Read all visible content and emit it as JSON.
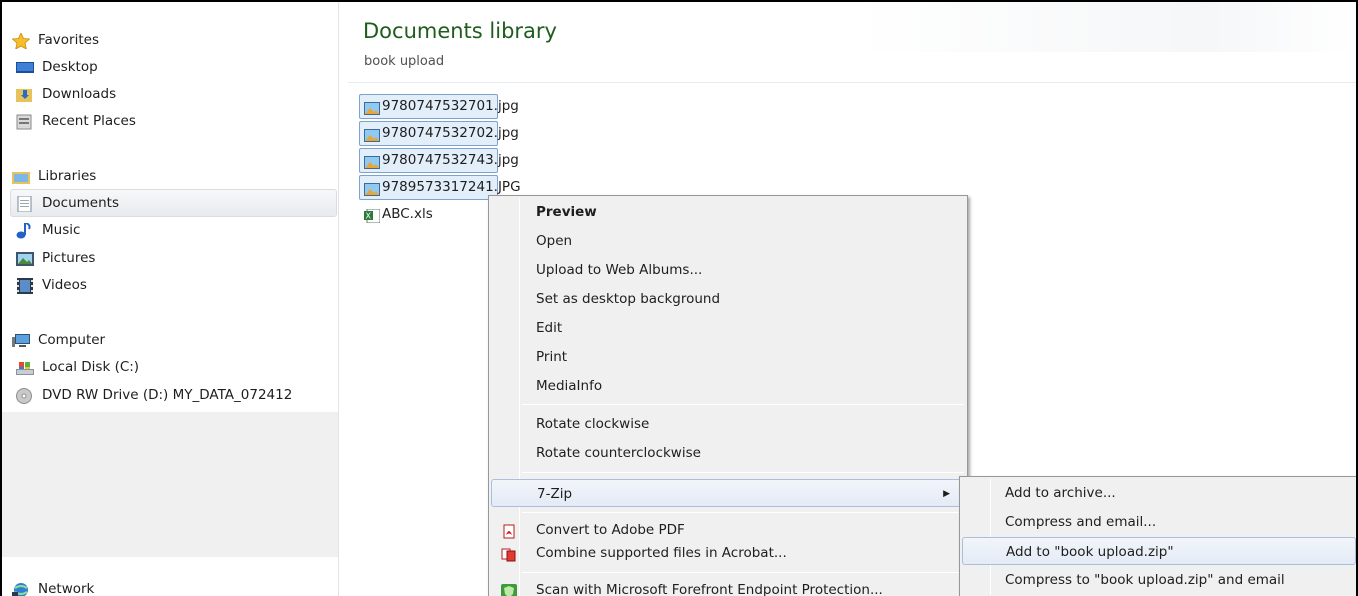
{
  "nav": {
    "favorites": "Favorites",
    "desktop": "Desktop",
    "downloads": "Downloads",
    "recent_places": "Recent Places",
    "libraries": "Libraries",
    "documents": "Documents",
    "music": "Music",
    "pictures": "Pictures",
    "videos": "Videos",
    "computer": "Computer",
    "local_disk": "Local Disk (C:)",
    "dvd_drive": "DVD RW Drive (D:) MY_DATA_072412",
    "network": "Network"
  },
  "header": {
    "title": "Documents library",
    "subtitle": "book upload"
  },
  "files": [
    {
      "name": "9780747532701.jpg",
      "icon": "image-file-icon",
      "selected": true
    },
    {
      "name": "9780747532702.jpg",
      "icon": "image-file-icon",
      "selected": true
    },
    {
      "name": "9780747532743.jpg",
      "icon": "image-file-icon",
      "selected": true
    },
    {
      "name": "9789573317241.JPG",
      "icon": "image-file-icon",
      "selected": true
    },
    {
      "name": "ABC.xls",
      "icon": "excel-file-icon",
      "selected": false
    }
  ],
  "context_menu": {
    "preview": "Preview",
    "open": "Open",
    "upload_web_albums": "Upload to Web Albums...",
    "set_desktop_background": "Set as desktop background",
    "edit": "Edit",
    "print": "Print",
    "mediainfo": "MediaInfo",
    "rotate_clockwise": "Rotate clockwise",
    "rotate_counterclockwise": "Rotate counterclockwise",
    "seven_zip": "7-Zip",
    "convert_pdf": "Convert to Adobe PDF",
    "combine_acrobat": "Combine supported files in Acrobat...",
    "scan_forefront": "Scan with Microsoft Forefront Endpoint Protection..."
  },
  "submenu": {
    "add_to_archive": "Add to archive...",
    "compress_email": "Compress and email...",
    "add_to_zip": "Add to \"book upload.zip\"",
    "compress_to_zip_email": "Compress to \"book upload.zip\" and email"
  },
  "colors": {
    "title_green": "#1e5d1e",
    "selection_bg": "#e3eefb",
    "selection_border": "#7da2ce",
    "menu_bg": "#f0f0f0"
  }
}
